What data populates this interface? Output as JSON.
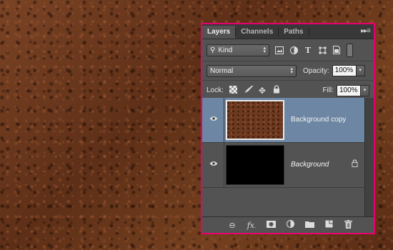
{
  "panel": {
    "tabs": [
      {
        "label": "Layers",
        "active": true
      },
      {
        "label": "Channels",
        "active": false
      },
      {
        "label": "Paths",
        "active": false
      }
    ],
    "menu_icon": "panel-menu-icon"
  },
  "filter": {
    "kind_label": "Kind",
    "icons": [
      "pixel-filter-icon",
      "adjustment-filter-icon",
      "type-filter-icon",
      "shape-filter-icon",
      "smart-object-filter-icon"
    ]
  },
  "blend": {
    "mode": "Normal",
    "opacity_label": "Opacity:",
    "opacity_value": "100%"
  },
  "lock": {
    "label": "Lock:",
    "icons": [
      "lock-transparent-icon",
      "lock-image-icon",
      "lock-position-icon",
      "lock-all-icon"
    ],
    "fill_label": "Fill:",
    "fill_value": "100%"
  },
  "layers": [
    {
      "name": "Background copy",
      "visible": true,
      "selected": true,
      "thumbnail": "dirt-texture",
      "locked": false
    },
    {
      "name": "Background",
      "visible": true,
      "selected": false,
      "thumbnail": "black",
      "locked": true
    }
  ],
  "bottom_icons": [
    "link-icon",
    "fx-icon",
    "mask-icon",
    "adjustment-icon",
    "group-folder-icon",
    "new-layer-icon",
    "trash-icon"
  ],
  "colors": {
    "highlight_border": "#e8006d",
    "selected_row": "#6c86a3",
    "panel_bg": "#535353"
  }
}
